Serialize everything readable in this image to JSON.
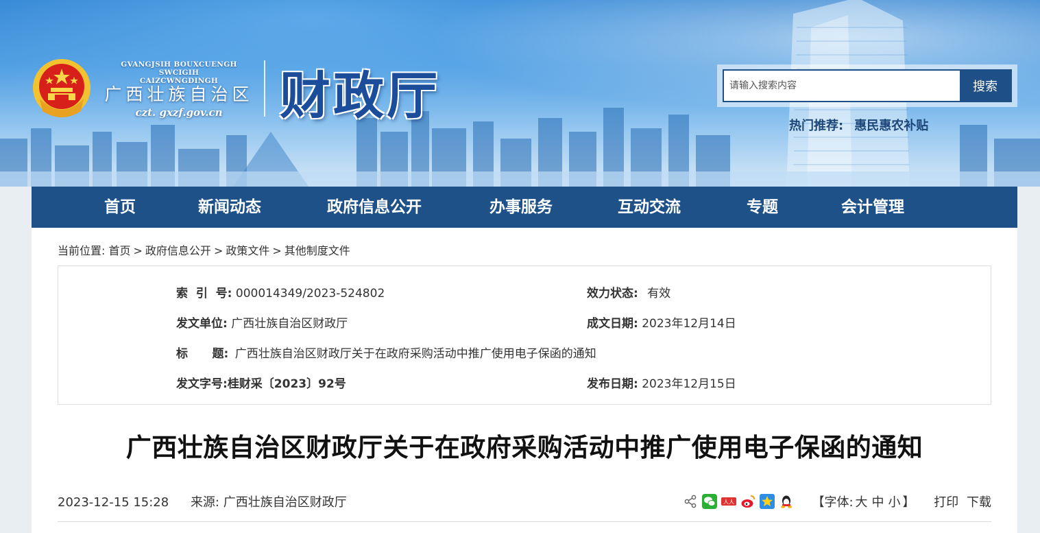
{
  "header": {
    "logo_pinyin_line1": "GVANGJSIH BOUXCUENGH SWCIGIH",
    "logo_pinyin_line2": "CAIZCWNGDINGH",
    "logo_cn": "广西壮族自治区",
    "logo_domain": "czt. gxzf.gov.cn",
    "dept_title": "财政厅",
    "search": {
      "placeholder": "请输入搜索内容",
      "button_label": "搜索"
    },
    "hot": {
      "label": "热门推荐:",
      "link": "惠民惠农补贴"
    }
  },
  "nav": {
    "items": [
      {
        "label": "首页"
      },
      {
        "label": "新闻动态"
      },
      {
        "label": "政府信息公开"
      },
      {
        "label": "办事服务"
      },
      {
        "label": "互动交流"
      },
      {
        "label": "专题"
      },
      {
        "label": "会计管理"
      }
    ]
  },
  "breadcrumb": {
    "prefix": "当前位置:",
    "items": [
      "首页",
      "政府信息公开",
      "政策文件",
      "其他制度文件"
    ],
    "separator": ">"
  },
  "meta": {
    "index_label": "索  引  号:",
    "index_value": "000014349/2023-524802",
    "status_label": "效力状态:",
    "status_value": "有效",
    "issuer_label": "发文单位:",
    "issuer_value": "广西壮族自治区财政厅",
    "created_label": "成文日期:",
    "created_value": "2023年12月14日",
    "title_label": "标      题:",
    "title_value": "广西壮族自治区财政厅关于在政府采购活动中推广使用电子保函的通知",
    "docno_label": "发文字号:",
    "docno_value": "桂财采〔2023〕92号",
    "published_label": "发布日期:",
    "published_value": "2023年12月15日"
  },
  "article": {
    "title": "广西壮族自治区财政厅关于在政府采购活动中推广使用电子保函的通知",
    "datetime": "2023-12-15 15:28",
    "source_label": "来源:",
    "source_value": "广西壮族自治区财政厅",
    "font_label_open": "【字体:",
    "font_large": "大",
    "font_medium": "中",
    "font_small": "小",
    "font_label_close": "】",
    "print_label": "打印",
    "download_label": "下载"
  },
  "share_icons": [
    "share-icon",
    "wechat-icon",
    "renren-icon",
    "weibo-icon",
    "qzone-icon",
    "qq-icon"
  ],
  "colors": {
    "nav_bg": "#1d5188",
    "title_blue": "#1b4d9a",
    "hot_text": "#1d4778"
  }
}
